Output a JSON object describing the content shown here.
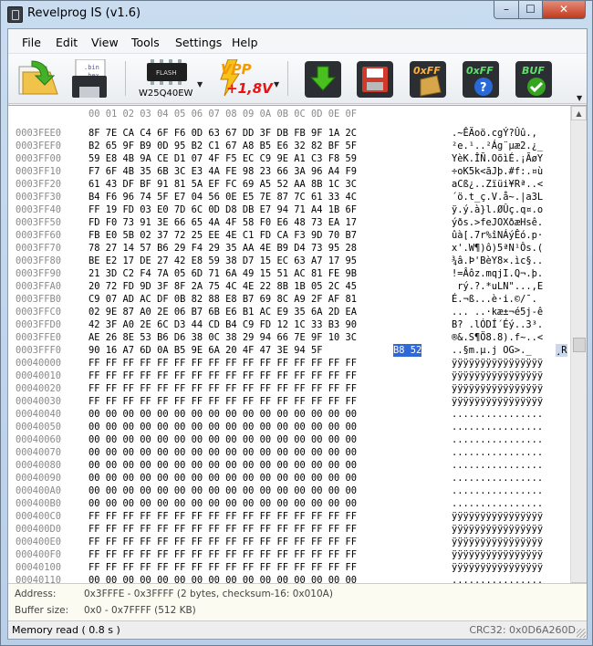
{
  "window": {
    "title": "Revelprog IS (v1.6)",
    "min": "–",
    "max": "☐",
    "close": "✕"
  },
  "menu": [
    "File",
    "Edit",
    "View",
    "Tools",
    "Settings",
    "Help"
  ],
  "toolbar": {
    "open_icon_text": ".bin\n.hex",
    "save_icon_text": ".bin\n.hex",
    "chip_label": "W25Q40EW",
    "chip_text": "FLASH",
    "vpp_text": "VPP",
    "vpp_value": "+1,8V",
    "erase_text": "0xFF",
    "blank_text": "0xFF",
    "buf_text": "BUF"
  },
  "hex": {
    "header": "00 01 02 03 04 05 06 07 08 09 0A 0B 0C 0D 0E 0F",
    "rows": [
      {
        "addr": "0003FEE0",
        "bytes": "8F 7E CA C4 6F F6 0D 63 67 DD 3F DB FB 9F 1A 2C",
        "ascii": ".~ÊÄoö.cgÝ?Ûû.,"
      },
      {
        "addr": "0003FEF0",
        "bytes": "B2 65 9F B9 0D 95 B2 C1 67 A8 B5 E6 32 82 BF 5F",
        "ascii": "²e.¹..²Ág¨µæ2.¿_"
      },
      {
        "addr": "0003FF00",
        "bytes": "59 E8 4B 9A CE D1 07 4F F5 EC C9 9E A1 C3 F8 59",
        "ascii": "YèK.ÎÑ.OõìÉ.¡ÃøY"
      },
      {
        "addr": "0003FF10",
        "bytes": "F7 6F 4B 35 6B 3C E3 4A FE 98 23 66 3A 96 A4 F9",
        "ascii": "÷oK5k<ãJþ.#f:.¤ù"
      },
      {
        "addr": "0003FF20",
        "bytes": "61 43 DF BF 91 81 5A EF FC 69 A5 52 AA 8B 1C 3C",
        "ascii": "aCß¿..Zïüi¥Rª..<"
      },
      {
        "addr": "0003FF30",
        "bytes": "B4 F6 96 74 5F E7 04 56 0E E5 7E 87 7C 61 33 4C",
        "ascii": "´ö.t_ç.V.å~.|a3L"
      },
      {
        "addr": "0003FF40",
        "bytes": "FF 19 FD 03 E0 7D 6C 0D D8 DB E7 94 71 A4 1B 6F",
        "ascii": "ÿ.ý.à}l.ØÛç.q¤.o"
      },
      {
        "addr": "0003FF50",
        "bytes": "FD F0 73 91 3E 66 65 4A 4F 58 F0 E6 48 73 EA 17",
        "ascii": "ýðs.>feJOXðæHsê."
      },
      {
        "addr": "0003FF60",
        "bytes": "FB E0 5B 02 37 72 25 EE 4E C1 FD CA F3 9D 70 B7",
        "ascii": "ûà[.7r%îNÁýÊó.p·"
      },
      {
        "addr": "0003FF70",
        "bytes": "78 27 14 57 B6 29 F4 29 35 AA 4E B9 D4 73 95 28",
        "ascii": "x'.W¶)ô)5ªN¹Ôs.("
      },
      {
        "addr": "0003FF80",
        "bytes": "BE E2 17 DE 27 42 E8 59 38 D7 15 EC 63 A7 17 95",
        "ascii": "¾â.Þ'BèY8×.ìc§.."
      },
      {
        "addr": "0003FF90",
        "bytes": "21 3D C2 F4 7A 05 6D 71 6A 49 15 51 AC 81 FE 9B",
        "ascii": "!=Âôz.mqjI.Q¬.þ."
      },
      {
        "addr": "0003FFA0",
        "bytes": "20 72 FD 9D 3F 8F 2A 75 4C 4E 22 8B 1B 05 2C 45",
        "ascii": " rý.?.*uLN\"...,E"
      },
      {
        "addr": "0003FFB0",
        "bytes": "C9 07 AD AC DF 0B 82 88 E8 B7 69 8C A9 2F AF 81",
        "ascii": "É.­¬ß...è·i.©/¯."
      },
      {
        "addr": "0003FFC0",
        "bytes": "02 9E 87 A0 2E 06 B7 6B E6 B1 AC E9 35 6A 2D EA",
        "ascii": "... ..·kæ±¬é5j-ê"
      },
      {
        "addr": "0003FFD0",
        "bytes": "42 3F A0 2E 6C D3 44 CD B4 C9 FD 12 1C 33 B3 90",
        "ascii": "B? .lÓDÍ´Éý..3³."
      },
      {
        "addr": "0003FFE0",
        "bytes": "AE 26 8E 53 B6 D6 38 0C 38 29 94 66 7E 9F 10 3C",
        "ascii": "®&.S¶Ö8.8).f~..<"
      },
      {
        "addr": "0003FFF0",
        "bytes": "90 16 A7 6D 0A B5 9E 6A 20 4F 47 3E 94 5F ",
        "ascii": "..§m.µ.j OG>._",
        "sel_bytes": "B8 52",
        "sel_ascii": "¸R"
      },
      {
        "addr": "00040000",
        "bytes": "FF FF FF FF FF FF FF FF FF FF FF FF FF FF FF FF",
        "ascii": "ÿÿÿÿÿÿÿÿÿÿÿÿÿÿÿÿ"
      },
      {
        "addr": "00040010",
        "bytes": "FF FF FF FF FF FF FF FF FF FF FF FF FF FF FF FF",
        "ascii": "ÿÿÿÿÿÿÿÿÿÿÿÿÿÿÿÿ"
      },
      {
        "addr": "00040020",
        "bytes": "FF FF FF FF FF FF FF FF FF FF FF FF FF FF FF FF",
        "ascii": "ÿÿÿÿÿÿÿÿÿÿÿÿÿÿÿÿ"
      },
      {
        "addr": "00040030",
        "bytes": "FF FF FF FF FF FF FF FF FF FF FF FF FF FF FF FF",
        "ascii": "ÿÿÿÿÿÿÿÿÿÿÿÿÿÿÿÿ"
      },
      {
        "addr": "00040040",
        "bytes": "00 00 00 00 00 00 00 00 00 00 00 00 00 00 00 00",
        "ascii": "................"
      },
      {
        "addr": "00040050",
        "bytes": "00 00 00 00 00 00 00 00 00 00 00 00 00 00 00 00",
        "ascii": "................"
      },
      {
        "addr": "00040060",
        "bytes": "00 00 00 00 00 00 00 00 00 00 00 00 00 00 00 00",
        "ascii": "................"
      },
      {
        "addr": "00040070",
        "bytes": "00 00 00 00 00 00 00 00 00 00 00 00 00 00 00 00",
        "ascii": "................"
      },
      {
        "addr": "00040080",
        "bytes": "00 00 00 00 00 00 00 00 00 00 00 00 00 00 00 00",
        "ascii": "................"
      },
      {
        "addr": "00040090",
        "bytes": "00 00 00 00 00 00 00 00 00 00 00 00 00 00 00 00",
        "ascii": "................"
      },
      {
        "addr": "000400A0",
        "bytes": "00 00 00 00 00 00 00 00 00 00 00 00 00 00 00 00",
        "ascii": "................"
      },
      {
        "addr": "000400B0",
        "bytes": "00 00 00 00 00 00 00 00 00 00 00 00 00 00 00 00",
        "ascii": "................"
      },
      {
        "addr": "000400C0",
        "bytes": "FF FF FF FF FF FF FF FF FF FF FF FF FF FF FF FF",
        "ascii": "ÿÿÿÿÿÿÿÿÿÿÿÿÿÿÿÿ"
      },
      {
        "addr": "000400D0",
        "bytes": "FF FF FF FF FF FF FF FF FF FF FF FF FF FF FF FF",
        "ascii": "ÿÿÿÿÿÿÿÿÿÿÿÿÿÿÿÿ"
      },
      {
        "addr": "000400E0",
        "bytes": "FF FF FF FF FF FF FF FF FF FF FF FF FF FF FF FF",
        "ascii": "ÿÿÿÿÿÿÿÿÿÿÿÿÿÿÿÿ"
      },
      {
        "addr": "000400F0",
        "bytes": "FF FF FF FF FF FF FF FF FF FF FF FF FF FF FF FF",
        "ascii": "ÿÿÿÿÿÿÿÿÿÿÿÿÿÿÿÿ"
      },
      {
        "addr": "00040100",
        "bytes": "FF FF FF FF FF FF FF FF FF FF FF FF FF FF FF FF",
        "ascii": "ÿÿÿÿÿÿÿÿÿÿÿÿÿÿÿÿ"
      },
      {
        "addr": "00040110",
        "bytes": "00 00 00 00 00 00 00 00 00 00 00 00 00 00 00 00",
        "ascii": "................"
      }
    ]
  },
  "info": {
    "address_label": "Address:",
    "address_value": "0x3FFFE - 0x3FFFF (2 bytes, checksum-16: 0x010A)",
    "buffer_label": "Buffer size:",
    "buffer_value": "0x0 - 0x7FFFF (512 KB)"
  },
  "status": {
    "left": "Memory read ( 0.8 s )",
    "right": "CRC32: 0x0D6A260D"
  },
  "colors": {
    "selection": "#3068d8",
    "titlebar": "#c9dcf0",
    "info_bg": "#fcfbf1"
  }
}
